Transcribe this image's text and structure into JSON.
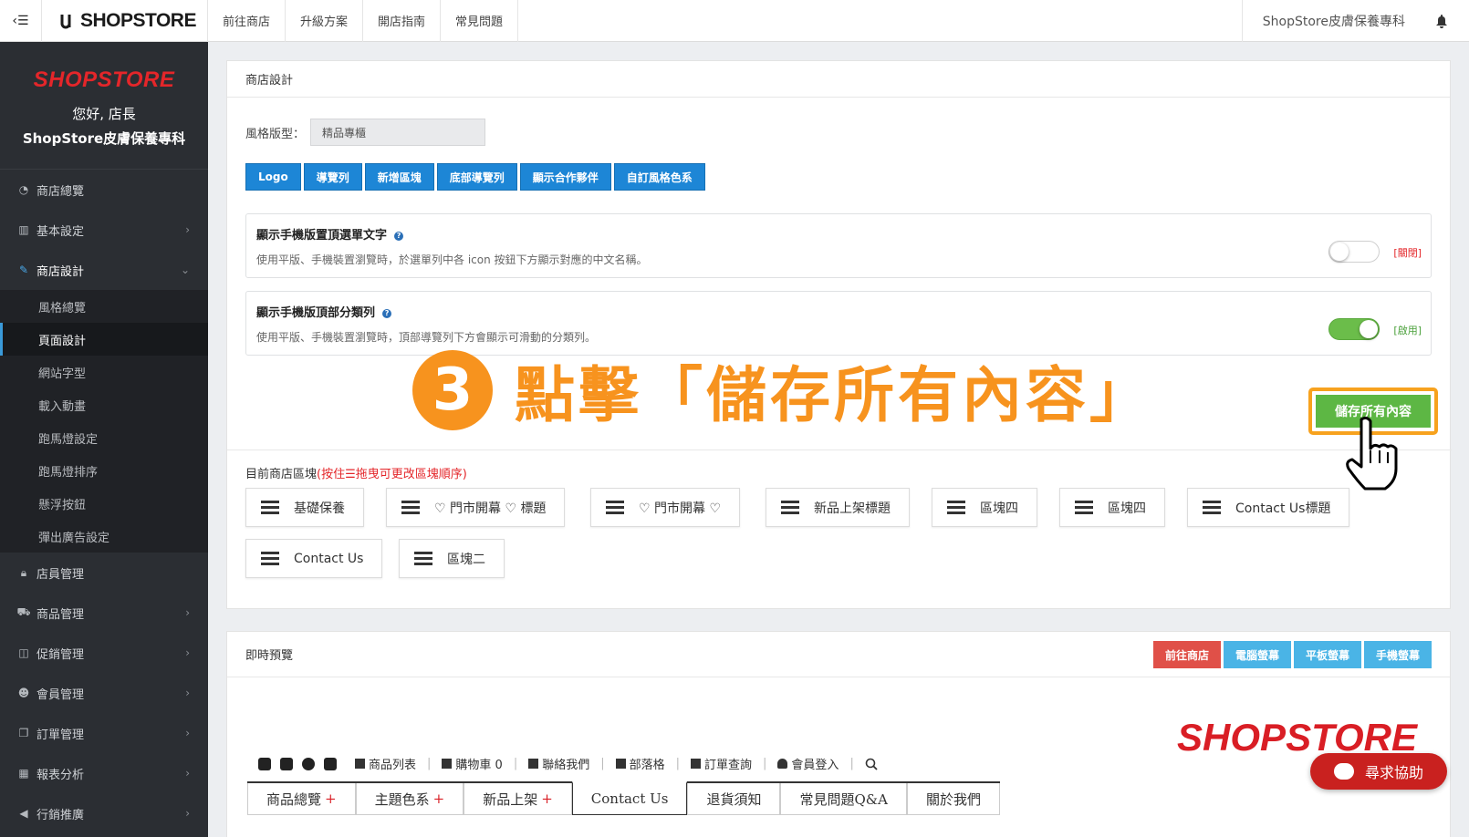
{
  "topbar": {
    "logo": "SHOPSTORE",
    "nav": [
      "前往商店",
      "升級方案",
      "開店指南",
      "常見問題"
    ],
    "store_name": "ShopStore皮膚保養專科"
  },
  "sidebar": {
    "logo": "SHOPSTORE",
    "greeting": "您好, 店長",
    "store_name": "ShopStore皮膚保養專科",
    "items": [
      {
        "label": "商店總覽",
        "icon": "dashboard-icon"
      },
      {
        "label": "基本設定",
        "icon": "bank-icon"
      },
      {
        "label": "商店設計",
        "icon": "wand-icon"
      },
      {
        "label": "店員管理",
        "icon": "lock-icon"
      },
      {
        "label": "商品管理",
        "icon": "cart-icon"
      },
      {
        "label": "促銷管理",
        "icon": "gift-icon"
      },
      {
        "label": "會員管理",
        "icon": "users-icon"
      },
      {
        "label": "訂單管理",
        "icon": "copy-icon"
      },
      {
        "label": "報表分析",
        "icon": "chart-icon"
      },
      {
        "label": "行銷推廣",
        "icon": "bullhorn-icon"
      }
    ],
    "subitems": [
      "風格總覽",
      "頁面設計",
      "網站字型",
      "載入動畫",
      "跑馬燈設定",
      "跑馬燈排序",
      "懸浮按鈕",
      "彈出廣告設定"
    ]
  },
  "design": {
    "title": "商店設計",
    "style_label": "風格版型：",
    "style_value": "精品專櫃",
    "buttons": [
      "Logo",
      "導覽列",
      "新增區塊",
      "底部導覽列",
      "顯示合作夥伴",
      "自訂風格色系"
    ],
    "options": [
      {
        "title": "顯示手機版置頂選單文字",
        "desc": "使用平版、手機裝置瀏覽時，於選單列中各 icon 按鈕下方顯示對應的中文名稱。",
        "state": "[關閉]",
        "enabled": false
      },
      {
        "title": "顯示手機版頂部分類列",
        "desc": "使用平版、手機裝置瀏覽時，頂部導覽列下方會顯示可滑動的分類列。",
        "state": "[啟用]",
        "enabled": true
      }
    ],
    "hint_number": "3",
    "hint_text": "點擊「儲存所有內容」",
    "save_label": "儲存所有內容",
    "blocks_title": "目前商店區塊",
    "blocks_note": "(按住☰拖曳可更改區塊順序)",
    "blocks": [
      "基礎保養",
      "♡ 門市開幕 ♡ 標題",
      "♡ 門市開幕 ♡",
      "新品上架標題",
      "區塊四",
      "區塊四",
      "Contact Us標題",
      "Contact Us",
      "區塊二"
    ]
  },
  "preview": {
    "title": "即時預覽",
    "buttons": [
      "前往商店",
      "電腦螢幕",
      "平板螢幕",
      "手機螢幕"
    ],
    "logo": "SHOPSTORE",
    "links": [
      "商品列表",
      "購物車 0",
      "聯絡我們",
      "部落格",
      "訂單查詢",
      "會員登入"
    ],
    "nav": [
      {
        "label": "商品總覽",
        "plus": "+"
      },
      {
        "label": "主題色系",
        "plus": "+"
      },
      {
        "label": "新品上架",
        "plus": "+"
      },
      {
        "label": "Contact Us",
        "plus": ""
      },
      {
        "label": "退貨須知",
        "plus": ""
      },
      {
        "label": "常見問題Q&A",
        "plus": ""
      },
      {
        "label": "關於我們",
        "plus": ""
      }
    ]
  },
  "help_button": "尋求協助",
  "colors": {
    "primary_blue": "#1d86d6",
    "save_green": "#5db744",
    "hint_orange": "#f7931e",
    "brand_red": "#d91e25"
  }
}
